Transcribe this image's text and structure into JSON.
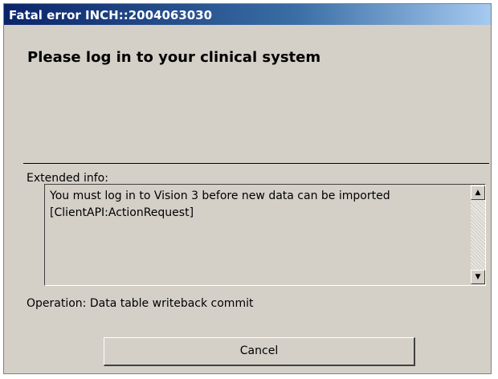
{
  "window": {
    "title": "Fatal error INCH::2004063030"
  },
  "dialog": {
    "heading": "Please log in to your clinical system",
    "extended_info_label": "Extended info:",
    "extended_info_lines": [
      "You must log in to Vision 3 before new data can be imported",
      "[ClientAPI:ActionRequest]"
    ],
    "operation": "Operation: Data table writeback commit",
    "cancel_label": "Cancel"
  },
  "icons": {
    "scroll_up": "arrow-up-icon",
    "scroll_down": "arrow-down-icon"
  },
  "colors": {
    "dialog_background": "#d4d0c8",
    "titlebar_start": "#0a246a",
    "titlebar_end": "#a6caf0"
  }
}
